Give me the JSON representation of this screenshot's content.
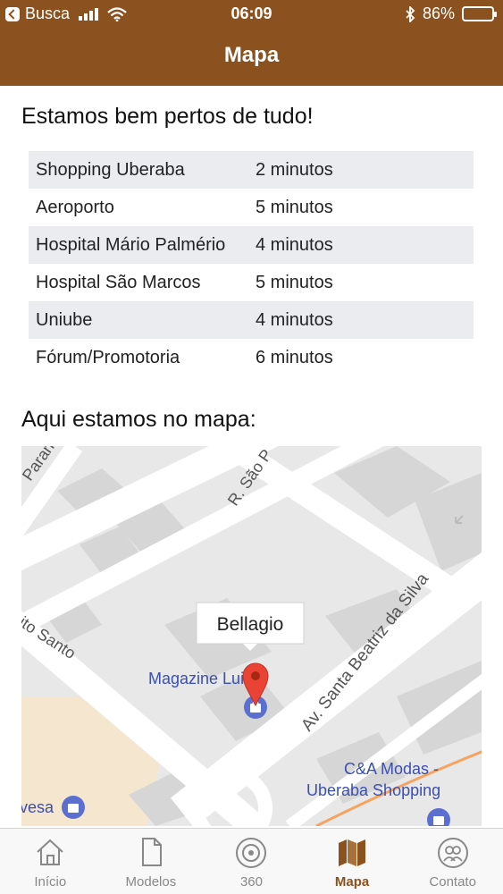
{
  "status_bar": {
    "back_app": "Busca",
    "time": "06:09",
    "battery": "86%",
    "battery_level": 0.86
  },
  "header": {
    "title": "Mapa"
  },
  "section1": {
    "title": "Estamos bem pertos de tudo!"
  },
  "distances": [
    {
      "place": "Shopping Uberaba",
      "time": "2 minutos"
    },
    {
      "place": "Aeroporto",
      "time": "5 minutos"
    },
    {
      "place": "Hospital Mário Palmério",
      "time": "4 minutos"
    },
    {
      "place": "Hospital São Marcos",
      "time": "5 minutos"
    },
    {
      "place": "Uniube",
      "time": "4 minutos"
    },
    {
      "place": "Fórum/Promotoria",
      "time": "6 minutos"
    }
  ],
  "section2": {
    "title": "Aqui estamos no mapa:"
  },
  "map": {
    "info_window": "Bellagio",
    "labels": {
      "street_parana": "Paraná",
      "street_sao_paulo": "R. São P",
      "street_espirito_santo": "ito Santo",
      "street_santa_beatriz": "Av. Santa Beatriz da Silva",
      "poi_magazine": "Magazine Luiza",
      "poi_cea_line1": "C&A Modas -",
      "poi_cea_line2": "Uberaba Shopping",
      "poi_vesa": "vesa"
    },
    "colors": {
      "road": "#ffffff",
      "block": "#dadada",
      "park": "#f4e6cf",
      "marker": "#ea4335",
      "poi": "#3b4fb0",
      "orange_road": "#f4a460"
    }
  },
  "tabs": [
    {
      "label": "Início",
      "icon": "home-icon",
      "active": false
    },
    {
      "label": "Modelos",
      "icon": "document-icon",
      "active": false
    },
    {
      "label": "360",
      "icon": "360-view-icon",
      "active": false
    },
    {
      "label": "Mapa",
      "icon": "map-icon",
      "active": true
    },
    {
      "label": "Contato",
      "icon": "contact-icon",
      "active": false
    }
  ],
  "colors": {
    "brand": "#8b5220",
    "table_stripe": "#ebecef"
  }
}
